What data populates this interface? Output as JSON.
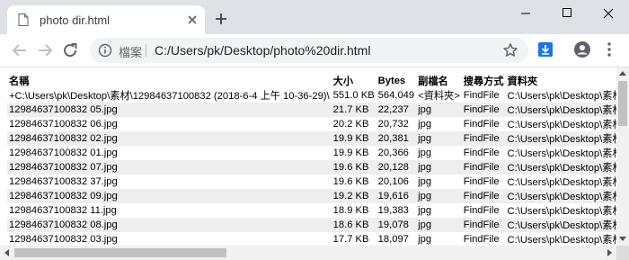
{
  "tab": {
    "title": "photo dir.html"
  },
  "omnibox": {
    "site_label": "檔案",
    "url": "C:/Users/pk/Desktop/photo%20dir.html"
  },
  "table": {
    "headers": [
      "名稱",
      "大小",
      "Bytes",
      "副檔名",
      "搜尋方式",
      "資料夾"
    ],
    "rows": [
      [
        "+C:\\Users\\pk\\Desktop\\素材\\12984637100832 (2018-6-4 上午 10-36-29)\\",
        "551.0 KB",
        "564,049",
        "<資料夾>",
        "FindFile",
        "C:\\Users\\pk\\Desktop\\素材"
      ],
      [
        "12984637100832 05.jpg",
        "21.7 KB",
        "22,237",
        "jpg",
        "FindFile",
        "C:\\Users\\pk\\Desktop\\素材"
      ],
      [
        "12984637100832 06.jpg",
        "20.2 KB",
        "20,732",
        "jpg",
        "FindFile",
        "C:\\Users\\pk\\Desktop\\素材"
      ],
      [
        "12984637100832 02.jpg",
        "19.9 KB",
        "20,381",
        "jpg",
        "FindFile",
        "C:\\Users\\pk\\Desktop\\素材"
      ],
      [
        "12984637100832 01.jpg",
        "19.9 KB",
        "20,366",
        "jpg",
        "FindFile",
        "C:\\Users\\pk\\Desktop\\素材"
      ],
      [
        "12984637100832 07.jpg",
        "19.6 KB",
        "20,128",
        "jpg",
        "FindFile",
        "C:\\Users\\pk\\Desktop\\素材"
      ],
      [
        "12984637100832 37.jpg",
        "19.6 KB",
        "20,106",
        "jpg",
        "FindFile",
        "C:\\Users\\pk\\Desktop\\素材"
      ],
      [
        "12984637100832 09.jpg",
        "19.2 KB",
        "19,616",
        "jpg",
        "FindFile",
        "C:\\Users\\pk\\Desktop\\素材"
      ],
      [
        "12984637100832 11.jpg",
        "18.9 KB",
        "19,383",
        "jpg",
        "FindFile",
        "C:\\Users\\pk\\Desktop\\素材"
      ],
      [
        "12984637100832 08.jpg",
        "18.6 KB",
        "19,078",
        "jpg",
        "FindFile",
        "C:\\Users\\pk\\Desktop\\素材"
      ],
      [
        "12984637100832 03.jpg",
        "17.7 KB",
        "18,097",
        "jpg",
        "FindFile",
        "C:\\Users\\pk\\Desktop\\素材"
      ]
    ]
  },
  "colors": {
    "tabstrip": "#dee1e6",
    "accent": "#1a73e8",
    "row_alt": "#eeeeee"
  },
  "icons": [
    "page-icon",
    "close-icon",
    "plus-icon",
    "minimize-icon",
    "maximize-icon",
    "window-close-icon",
    "back-arrow-icon",
    "forward-arrow-icon",
    "reload-icon",
    "info-icon",
    "star-icon",
    "download-extension-icon",
    "account-icon",
    "kebab-menu-icon"
  ]
}
